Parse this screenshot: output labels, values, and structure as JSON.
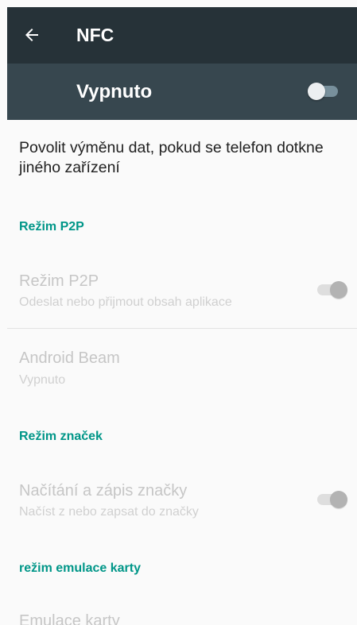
{
  "toolbar": {
    "title": "NFC",
    "back_icon": "arrow-left-icon",
    "background": "#263238"
  },
  "master": {
    "label": "Vypnuto",
    "switch_on": false,
    "background": "#37474f"
  },
  "description": "Povolit výměnu dat, pokud se telefon dotkne jiného zařízení",
  "sections": {
    "p2p": {
      "header": "Režim P2P",
      "item_title": "Režim P2P",
      "item_summary": "Odeslat nebo přijmout obsah aplikace",
      "switch_on": true
    },
    "beam": {
      "title": "Android Beam",
      "summary": "Vypnuto"
    },
    "tags": {
      "header": "Režim značek",
      "item_title": "Načítání a zápis značky",
      "item_summary": "Načíst z nebo zapsat do značky",
      "switch_on": true
    },
    "emulation": {
      "header": "režim emulace karty",
      "item_title": "Emulace karty"
    }
  },
  "colors": {
    "accent": "#009688",
    "disabled_text": "#c6c6c6",
    "primary_text": "#212121"
  }
}
